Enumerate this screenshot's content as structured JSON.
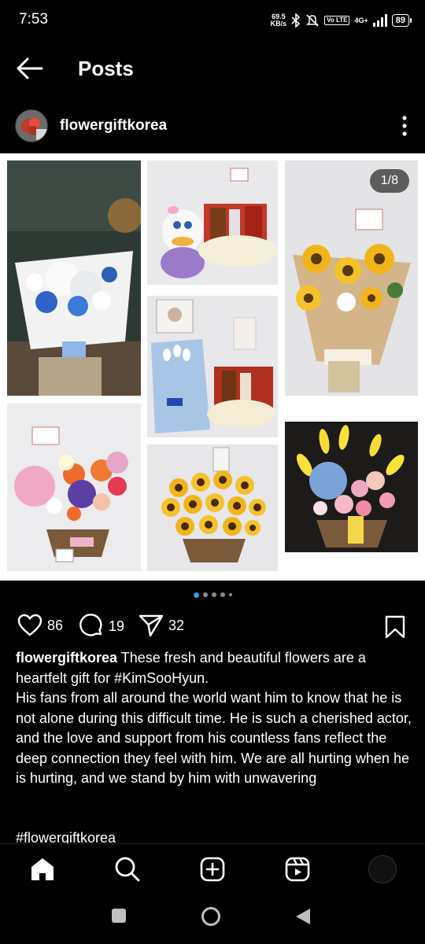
{
  "status_bar": {
    "time": "7:53",
    "net_speed_value": "69.5",
    "net_speed_unit": "KB/s",
    "volte": "Vo LTE",
    "network": "4G+",
    "battery": "89"
  },
  "header": {
    "title": "Posts"
  },
  "post": {
    "username": "flowergiftkorea",
    "page_counter": "1/8",
    "carousel": {
      "total_dots": 5,
      "active_index": 0
    },
    "likes": "86",
    "comments": "19",
    "shares": "32",
    "caption_user": "flowergiftkorea",
    "caption_text": "These fresh and beautiful flowers are a heartfelt gift for #KimSooHyun.",
    "caption_body": "His fans from all around the world want him to know that he is not alone during this difficult time. He is such a cherished actor, and the love and support from his countless fans reflect the deep connection they feel with him. We are all hurting when he is hurting, and we stand by him with unwavering",
    "caption_hashtag": "#flowergiftkorea"
  },
  "colors": {
    "background": "#000000",
    "accent_blue": "#3897f0",
    "text": "#ffffff"
  },
  "icons": {
    "back": "arrow-left-icon",
    "more": "more-vertical-icon",
    "like": "heart-icon",
    "comment": "comment-icon",
    "share": "send-icon",
    "save": "bookmark-icon",
    "home": "home-icon",
    "search": "search-icon",
    "create": "plus-square-icon",
    "reels": "reels-icon"
  }
}
